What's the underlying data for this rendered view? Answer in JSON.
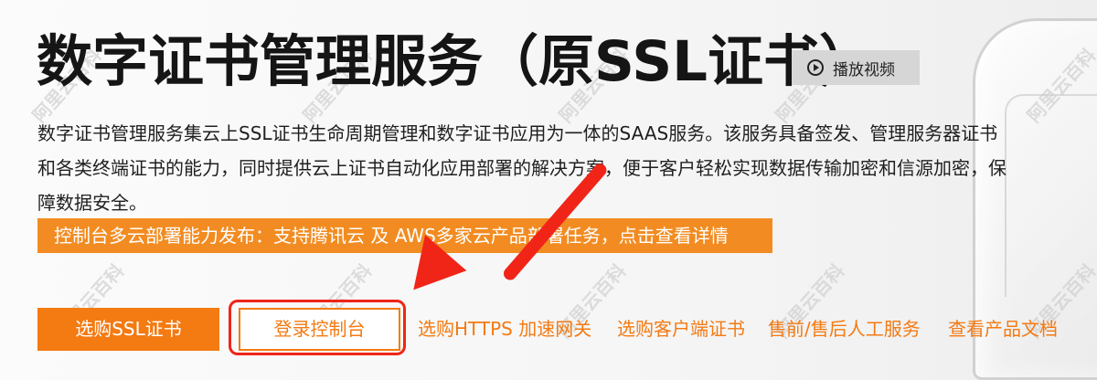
{
  "page": {
    "title": "数字证书管理服务（原SSL证书）",
    "video_button_label": "播放视频",
    "description": "数字证书管理服务集云上SSL证书生命周期管理和数字证书应用为一体的SAAS服务。该服务具备签发、管理服务器证书和各类终端证书的能力，同时提供云上证书自动化应用部署的解决方案，便于客户轻松实现数据传输加密和信源加密，保障数据安全。",
    "notice": "控制台多云部署能力发布：支持腾讯云 及 AWS多家云产品部署任务，点击查看详情"
  },
  "actions": {
    "buy_ssl": "选购SSL证书",
    "login_console": "登录控制台",
    "buy_https_gateway": "选购HTTPS 加速网关",
    "buy_client_cert": "选购客户端证书",
    "human_service": "售前/售后人工服务",
    "product_docs": "查看产品文档"
  },
  "watermark": {
    "text": "阿里云百科"
  },
  "icons": {
    "play": "play-circle-icon",
    "arrow": "red-callout-arrow-icon"
  },
  "colors": {
    "accent": "#f47a12",
    "notice_background": "#f28c22",
    "highlight": "#f02518",
    "video_button_background": "#d6d6d6"
  }
}
